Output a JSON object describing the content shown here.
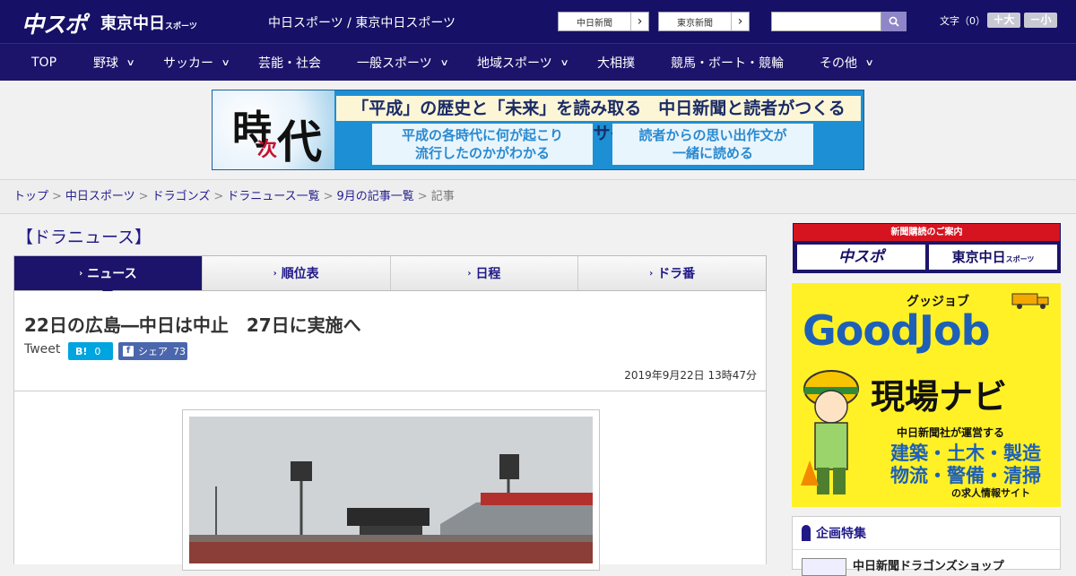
{
  "header": {
    "logo_chuspo": "中スポ",
    "logo_tokyo": "東京中日",
    "logo_tokyo_small": "スポーツ",
    "title": "中日スポーツ / 東京中日スポーツ",
    "btn_chunichi": "中日新聞",
    "btn_tokyo": "東京新聞",
    "search_placeholder": "",
    "font_label": "文字（0）",
    "font_bigger": "＋大",
    "font_smaller": "－小"
  },
  "nav": {
    "items": [
      {
        "label": "TOP",
        "chevron": false
      },
      {
        "label": "野球",
        "chevron": true
      },
      {
        "label": "サッカー",
        "chevron": true
      },
      {
        "label": "芸能・社会",
        "chevron": false
      },
      {
        "label": "一般スポーツ",
        "chevron": true
      },
      {
        "label": "地域スポーツ",
        "chevron": true
      },
      {
        "label": "大相撲",
        "chevron": false
      },
      {
        "label": "競馬・ボート・競輪",
        "chevron": false
      },
      {
        "label": "その他",
        "chevron": true
      }
    ]
  },
  "banner": {
    "logo_chars": [
      "時",
      "次",
      "代"
    ],
    "headline": "「平成」の歴史と「未来」を読み取る　中日新聞と読者がつくるWebサイト",
    "box_left_1": "平成の各時代に何が起こり",
    "box_left_2": "流行したのかがわかる",
    "box_right_1": "読者からの思い出作文が",
    "box_right_2": "一緒に読める"
  },
  "breadcrumb": {
    "items": [
      "トップ",
      "中日スポーツ",
      "ドラゴンズ",
      "ドラニュース一覧",
      "9月の記事一覧"
    ],
    "current": "記事"
  },
  "section_title": "【ドラニュース】",
  "tabs": [
    {
      "label": "ニュース",
      "active": true
    },
    {
      "label": "順位表",
      "active": false
    },
    {
      "label": "日程",
      "active": false
    },
    {
      "label": "ドラ番",
      "active": false
    }
  ],
  "article": {
    "headline": "22日の広島―中日は中止　27日に実施へ",
    "tweet": "Tweet",
    "hatena_label": "B!",
    "hatena_count": "0",
    "fb_label": "シェア",
    "fb_count": "73",
    "date": "2019年9月22日 13時47分"
  },
  "sidebar": {
    "subscribe_title": "新聞購読のご案内",
    "subscribe_chuspo": "中スポ",
    "subscribe_tokyo": "東京中日",
    "subscribe_tokyo_small": "スポーツ",
    "ad_small": "グッジョブ",
    "ad_big": "GoodJob",
    "ad_navi": "現場ナビ",
    "ad_line": "中日新聞社が運営する",
    "ad_jobs_1": "建築・土木・製造",
    "ad_jobs_2": "物流・警備・清掃",
    "ad_foot": "の求人情報サイト",
    "kikaku_title": "企画特集",
    "kikaku_item": "中日新聞ドラゴンズショップ"
  },
  "colors": {
    "header_bg": "#161066",
    "nav_bg": "#1c146b",
    "link": "#26208f",
    "ad_yellow": "#fff126",
    "ad_blue": "#1e60b8"
  }
}
